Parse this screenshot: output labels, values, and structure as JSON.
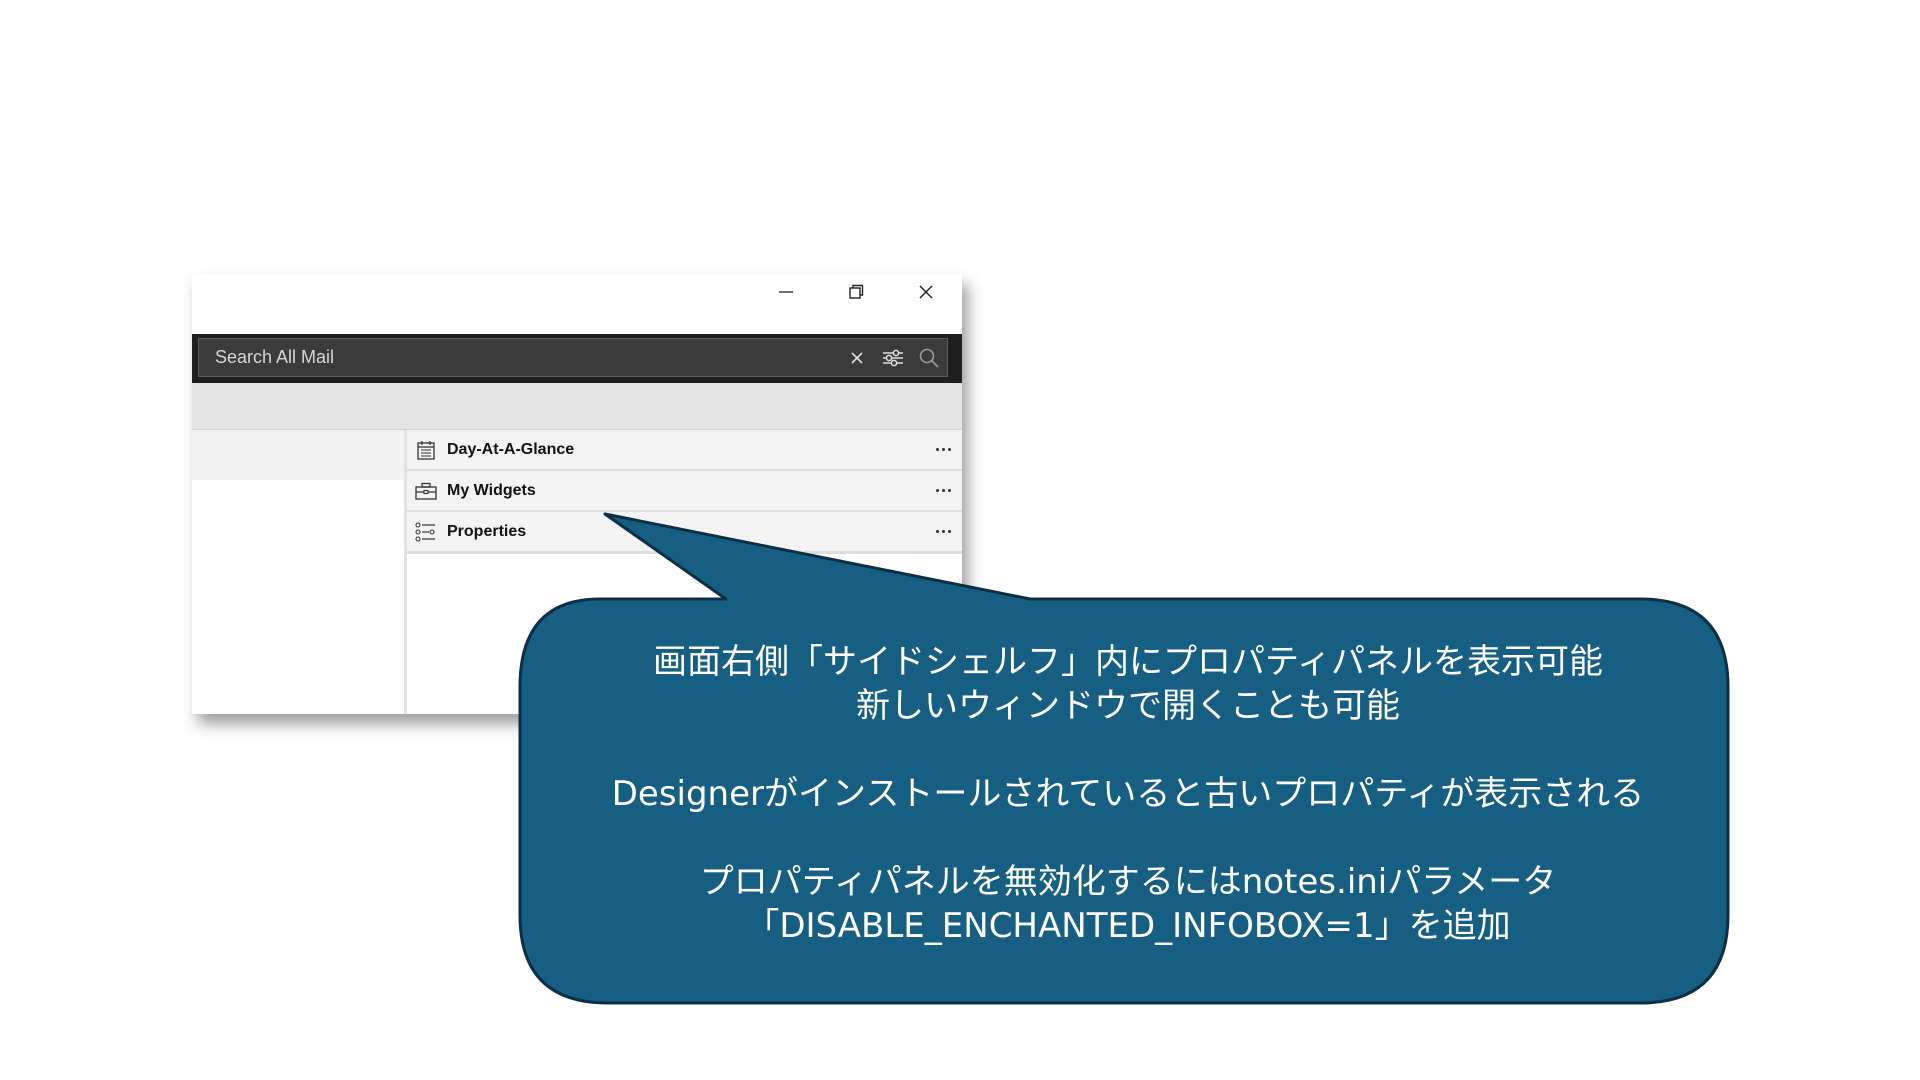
{
  "window": {
    "controls": {
      "minimize_icon": "minimize-icon",
      "restore_icon": "restore-icon",
      "close_icon": "close-icon"
    }
  },
  "search": {
    "placeholder": "Search All Mail",
    "value": "",
    "clear_icon": "close-icon",
    "filter_icon": "sliders-icon",
    "search_icon": "search-icon"
  },
  "side_shelf": {
    "items": [
      {
        "label": "Day-At-A-Glance",
        "icon": "calendar-icon"
      },
      {
        "label": "My Widgets",
        "icon": "toolbox-icon"
      },
      {
        "label": "Properties",
        "icon": "properties-icon"
      }
    ],
    "more_icon": "more-icon"
  },
  "callout": {
    "lines": [
      "画面右側「サイドシェルフ」内にプロパティパネルを表示可能",
      "新しいウィンドウで開くことも可能",
      "Designerがインストールされていると古いプロパティが表示される",
      "プロパティパネルを無効化するにはnotes.iniパラメータ",
      "「DISABLE_ENCHANTED_INFOBOX=1」を追加"
    ]
  },
  "colors": {
    "callout_fill": "#165f82",
    "callout_border": "#0d2f44",
    "search_strip": "#1f1f1f",
    "search_box": "#3b3b3b",
    "toolbar": "#e4e4e4",
    "shelf_item": "#f3f3f3"
  }
}
